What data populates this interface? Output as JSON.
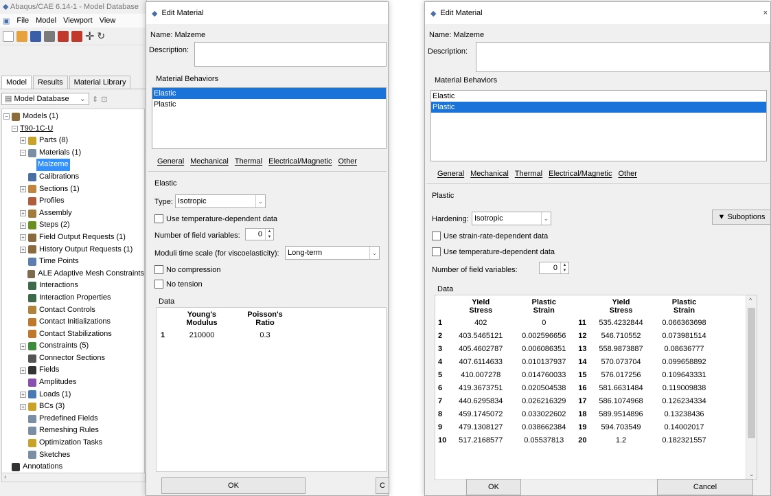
{
  "main": {
    "title": "Abaqus/CAE 6.14-1 - Model Database",
    "menu": [
      "File",
      "Model",
      "Viewport",
      "View"
    ],
    "tabs": [
      "Model",
      "Results",
      "Material Library"
    ],
    "db_select": "Model Database",
    "tree": [
      {
        "label": "Models (1)",
        "indent": 0,
        "exp": "⊟",
        "color": "#8a6d3b"
      },
      {
        "label": "T90-1C-U",
        "indent": 1,
        "exp": "⊟",
        "color": "",
        "underline": true
      },
      {
        "label": "Parts (8)",
        "indent": 2,
        "exp": "⊞",
        "color": "#c9a227"
      },
      {
        "label": "Materials (1)",
        "indent": 2,
        "exp": "⊟",
        "color": "#7a8fa6"
      },
      {
        "label": "Malzeme",
        "indent": 3,
        "exp": "",
        "color": "",
        "selected": true
      },
      {
        "label": "Calibrations",
        "indent": 2,
        "exp": "",
        "color": "#4a6fa5"
      },
      {
        "label": "Sections (1)",
        "indent": 2,
        "exp": "⊞",
        "color": "#c2853d"
      },
      {
        "label": "Profiles",
        "indent": 2,
        "exp": "",
        "color": "#b35c3c"
      },
      {
        "label": "Assembly",
        "indent": 2,
        "exp": "⊞",
        "color": "#a37a3a"
      },
      {
        "label": "Steps (2)",
        "indent": 2,
        "exp": "⊞",
        "color": "#6b8e23"
      },
      {
        "label": "Field Output Requests (1)",
        "indent": 2,
        "exp": "⊞",
        "color": "#8b6b3e"
      },
      {
        "label": "History Output Requests (1)",
        "indent": 2,
        "exp": "⊞",
        "color": "#8b6b3e"
      },
      {
        "label": "Time Points",
        "indent": 2,
        "exp": "",
        "color": "#5b7fb0"
      },
      {
        "label": "ALE Adaptive Mesh Constraints",
        "indent": 2,
        "exp": "",
        "color": "#7d6b4f"
      },
      {
        "label": "Interactions",
        "indent": 2,
        "exp": "",
        "color": "#3d6b4a"
      },
      {
        "label": "Interaction Properties",
        "indent": 2,
        "exp": "",
        "color": "#3d6b4a"
      },
      {
        "label": "Contact Controls",
        "indent": 2,
        "exp": "",
        "color": "#b0823a"
      },
      {
        "label": "Contact Initializations",
        "indent": 2,
        "exp": "",
        "color": "#c0792a"
      },
      {
        "label": "Contact Stabilizations",
        "indent": 2,
        "exp": "",
        "color": "#c0792a"
      },
      {
        "label": "Constraints (5)",
        "indent": 2,
        "exp": "⊞",
        "color": "#3d8b3d"
      },
      {
        "label": "Connector Sections",
        "indent": 2,
        "exp": "",
        "color": "#555555"
      },
      {
        "label": "Fields",
        "indent": 2,
        "exp": "⊞",
        "color": "#333333"
      },
      {
        "label": "Amplitudes",
        "indent": 2,
        "exp": "",
        "color": "#8a4fb0"
      },
      {
        "label": "Loads (1)",
        "indent": 2,
        "exp": "⊞",
        "color": "#4a7ab5"
      },
      {
        "label": "BCs (3)",
        "indent": 2,
        "exp": "⊞",
        "color": "#c9a227"
      },
      {
        "label": "Predefined Fields",
        "indent": 2,
        "exp": "",
        "color": "#7a8fa6"
      },
      {
        "label": "Remeshing Rules",
        "indent": 2,
        "exp": "",
        "color": "#7a8fa6"
      },
      {
        "label": "Optimization Tasks",
        "indent": 2,
        "exp": "",
        "color": "#c9a227"
      },
      {
        "label": "Sketches",
        "indent": 2,
        "exp": "",
        "color": "#7a8fa6"
      },
      {
        "label": "Annotations",
        "indent": 0,
        "exp": "",
        "color": "#333333"
      }
    ]
  },
  "elastic_dialog": {
    "title": "Edit Material",
    "name_label": "Name:",
    "name_value": "Malzeme",
    "description_label": "Description:",
    "behaviors_label": "Material Behaviors",
    "behaviors": [
      "Elastic",
      "Plastic"
    ],
    "selected_behavior": 0,
    "menu_tabs": [
      "General",
      "Mechanical",
      "Thermal",
      "Electrical/Magnetic",
      "Other"
    ],
    "section_label": "Elastic",
    "type_label": "Type:",
    "type_value": "Isotropic",
    "use_temp": "Use temperature-dependent data",
    "num_field_label": "Number of field variables:",
    "num_field_value": "0",
    "moduli_label": "Moduli time scale (for viscoelasticity):",
    "moduli_value": "Long-term",
    "no_compression": "No compression",
    "no_tension": "No tension",
    "data_label": "Data",
    "columns": [
      "Young's\nModulus",
      "Poisson's\nRatio"
    ],
    "rows": [
      [
        "1",
        "210000",
        "0.3"
      ]
    ],
    "ok": "OK",
    "cancel_partial": "C"
  },
  "plastic_dialog": {
    "title": "Edit Material",
    "name_label": "Name:",
    "name_value": "Malzeme",
    "description_label": "Description:",
    "behaviors_label": "Material Behaviors",
    "behaviors": [
      "Elastic",
      "Plastic"
    ],
    "selected_behavior": 1,
    "menu_tabs": [
      "General",
      "Mechanical",
      "Thermal",
      "Electrical/Magnetic",
      "Other"
    ],
    "section_label": "Plastic",
    "hardening_label": "Hardening:",
    "hardening_value": "Isotropic",
    "suboptions": "▼ Suboptions",
    "use_strain_rate": "Use strain-rate-dependent data",
    "use_temp": "Use temperature-dependent data",
    "num_field_label": "Number of field variables:",
    "num_field_value": "0",
    "data_label": "Data",
    "columns": [
      "Yield\nStress",
      "Plastic\nStrain"
    ],
    "rows_left": [
      [
        "1",
        "402",
        "0"
      ],
      [
        "2",
        "403.5465121",
        "0.002596656"
      ],
      [
        "3",
        "405.4602787",
        "0.006086351"
      ],
      [
        "4",
        "407.6114633",
        "0.010137937"
      ],
      [
        "5",
        "410.007278",
        "0.014760033"
      ],
      [
        "6",
        "419.3673751",
        "0.020504538"
      ],
      [
        "7",
        "440.6295834",
        "0.026216329"
      ],
      [
        "8",
        "459.1745072",
        "0.033022602"
      ],
      [
        "9",
        "479.1308127",
        "0.038662384"
      ],
      [
        "10",
        "517.2168577",
        "0.05537813"
      ]
    ],
    "rows_right": [
      [
        "11",
        "535.4232844",
        "0.066363698"
      ],
      [
        "12",
        "546.710552",
        "0.073981514"
      ],
      [
        "13",
        "558.9873887",
        "0.08636777"
      ],
      [
        "14",
        "570.073704",
        "0.099658892"
      ],
      [
        "15",
        "576.017256",
        "0.109643331"
      ],
      [
        "16",
        "581.6631484",
        "0.119009838"
      ],
      [
        "17",
        "586.1074968",
        "0.126234334"
      ],
      [
        "18",
        "589.9514896",
        "0.13238436"
      ],
      [
        "19",
        "594.703549",
        "0.14002017"
      ],
      [
        "20",
        "1.2",
        "0.182321557"
      ]
    ],
    "ok": "OK",
    "cancel": "Cancel"
  }
}
